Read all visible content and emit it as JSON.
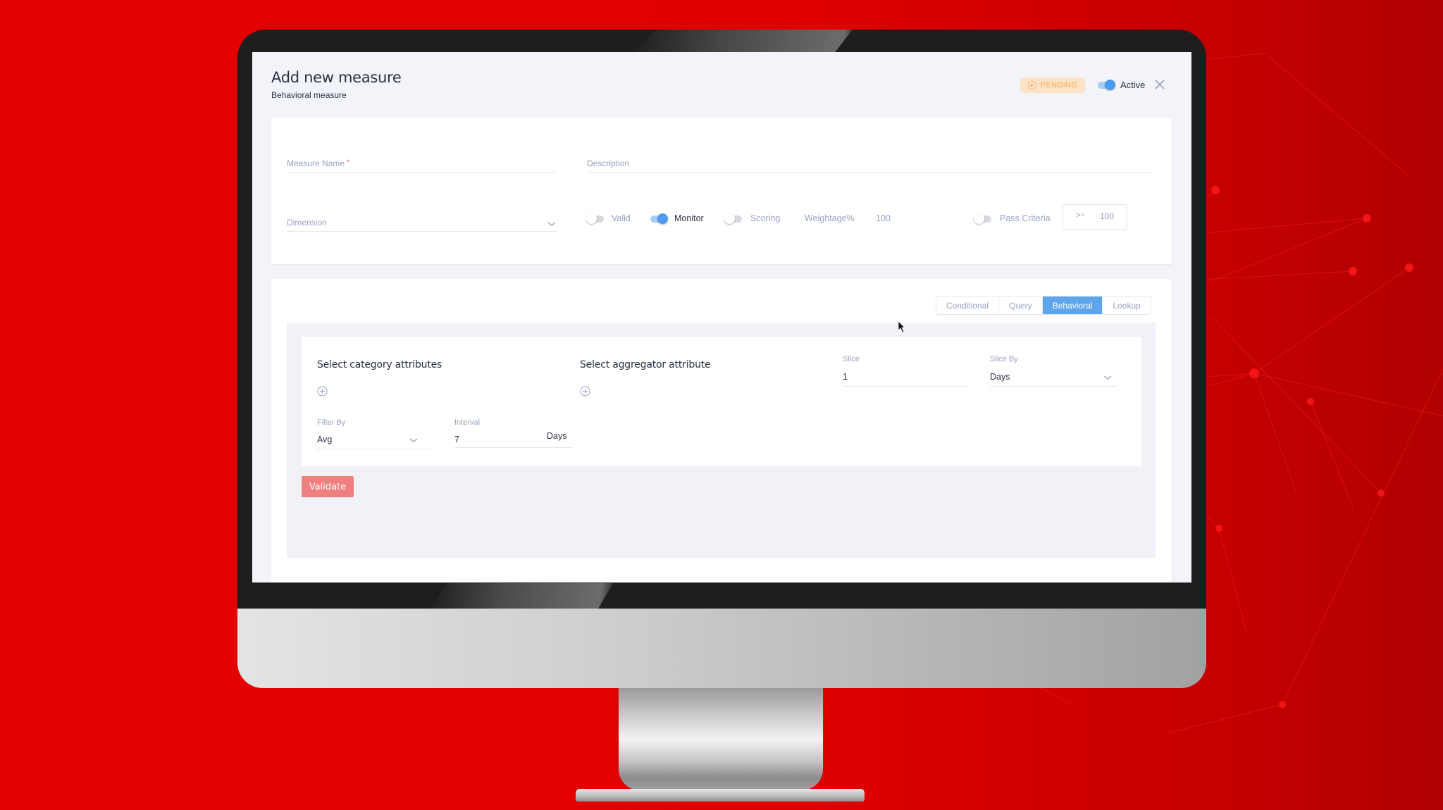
{
  "header": {
    "title": "Add new measure",
    "subtitle": "Behavioral measure",
    "status_badge": "PENDING",
    "active_toggle": {
      "label": "Active",
      "on": true
    }
  },
  "measure_form": {
    "measure_name": {
      "label": "Measure Name",
      "required_mark": "*",
      "value": ""
    },
    "description": {
      "label": "Description",
      "value": ""
    },
    "dimension": {
      "label": "Dimension",
      "value": ""
    },
    "options": [
      {
        "label": "Valid",
        "on": false
      },
      {
        "label": "Monitor",
        "on": true
      },
      {
        "label": "Scoring",
        "on": false
      }
    ],
    "weightage": {
      "label": "Weightage%",
      "value": "100"
    },
    "pass_criteria": {
      "label": "Pass Criteria",
      "on": false,
      "operator": ">=",
      "value": "100"
    }
  },
  "measure_type": {
    "tabs": [
      {
        "label": "Conditional",
        "active": false
      },
      {
        "label": "Query",
        "active": false
      },
      {
        "label": "Behavioral",
        "active": true
      },
      {
        "label": "Lookup",
        "active": false
      }
    ]
  },
  "behavioral": {
    "category_title": "Select category attributes",
    "aggregator_title": "Select aggregator attribute",
    "slice": {
      "label": "Slice",
      "value": "1"
    },
    "slice_by": {
      "label": "Slice By",
      "value": "Days"
    },
    "filter_by": {
      "label": "Filter By",
      "value": "Avg"
    },
    "interval": {
      "label": "Interval",
      "value": "7",
      "unit": "Days"
    },
    "validate_label": "Validate"
  },
  "colors": {
    "accent": "#5ea5ec",
    "toggle_on": "#4d9bf2",
    "validate": "#f07f7f",
    "pending_bg": "#fde3c6",
    "pending_text": "#f6a94c",
    "background": "#e30000"
  }
}
